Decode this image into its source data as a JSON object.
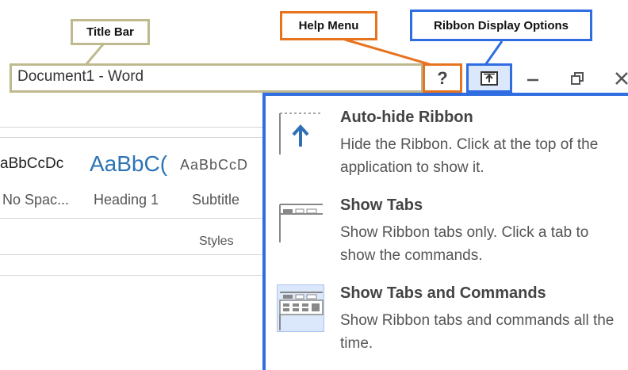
{
  "callouts": {
    "title_bar": "Title Bar",
    "help_menu": "Help Menu",
    "ribbon_display_options": "Ribbon Display Options"
  },
  "titlebar": {
    "title": "Document1 - Word",
    "help_glyph": "?",
    "minimize_glyph": "—",
    "restore_glyph": "⧉",
    "close_glyph": "✕"
  },
  "styles_gallery": {
    "samples": [
      {
        "preview": "aBbCcDc",
        "name": "No Spac..."
      },
      {
        "preview": "AaBbC(",
        "name": "Heading 1"
      },
      {
        "preview": "AaBbCcD",
        "name": "Subtitle"
      }
    ],
    "group_label": "Styles"
  },
  "ribbon_menu": {
    "options": [
      {
        "title": "Auto-hide Ribbon",
        "description": "Hide the Ribbon. Click at the top of the application to show it.",
        "icon": "auto-hide-ribbon-icon"
      },
      {
        "title": "Show Tabs",
        "description": "Show Ribbon tabs only. Click a tab to show the commands.",
        "icon": "show-tabs-icon"
      },
      {
        "title": "Show Tabs and Commands",
        "description": "Show Ribbon tabs and commands all the time.",
        "icon": "show-tabs-commands-icon",
        "selected": true
      }
    ]
  },
  "colors": {
    "title_callout": "#bfb98f",
    "help_callout": "#e8731f",
    "ribbon_callout": "#2f6de0",
    "heading_blue": "#2e74b5"
  }
}
